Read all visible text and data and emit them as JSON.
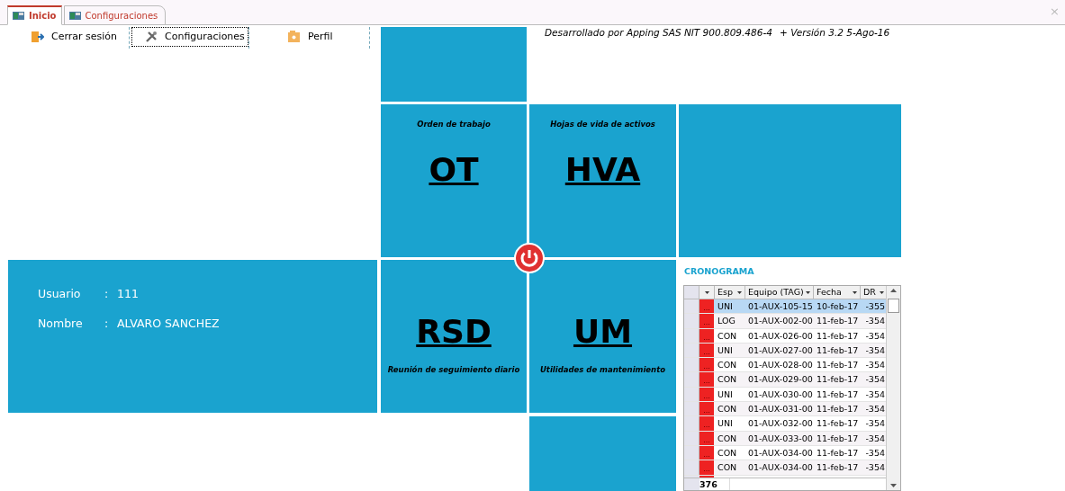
{
  "close_glyph": "×",
  "tabs": [
    {
      "label": "Inicio",
      "selected": true
    },
    {
      "label": "Configuraciones",
      "selected": false
    }
  ],
  "toolbar": [
    {
      "label": "Cerrar sesión",
      "kind": "logout",
      "focused": false
    },
    {
      "label": "Configuraciones",
      "kind": "tools",
      "focused": true
    },
    {
      "label": "Perfil",
      "kind": "profile",
      "focused": false
    }
  ],
  "developer_note": "Desarrollado por Apping SAS NIT 900.809.486-4",
  "version_note": "+ Versión 3.2  5-Ago-16",
  "tiles": [
    {
      "caption": "Orden de trabajo",
      "code": "OT",
      "kind": "caption-above"
    },
    {
      "caption": "Hojas de vida de activos",
      "code": "HVA",
      "kind": "caption-above"
    },
    {
      "caption": "Reunión de seguimiento diario",
      "code": "RSD",
      "kind": "caption-below"
    },
    {
      "caption": "Utilidades de mantenimiento",
      "code": "UM",
      "kind": "caption-below"
    }
  ],
  "user": {
    "fields": [
      {
        "label": "Usuario",
        "separator": ":",
        "value": "111"
      },
      {
        "label": "Nombre",
        "separator": ":",
        "value": "ALVARO SANCHEZ"
      }
    ]
  },
  "schedule": {
    "title": "CRONOGRAMA",
    "columns": [
      "Esp",
      "Equipo (TAG)",
      "Fecha",
      "DR"
    ],
    "rows": [
      {
        "esp": "UNI",
        "equipo": "01-AUX-105-15",
        "fecha": "10-feb-17",
        "dr": "-355",
        "selected": true
      },
      {
        "esp": "LOG",
        "equipo": "01-AUX-002-00",
        "fecha": "11-feb-17",
        "dr": "-354",
        "selected": false
      },
      {
        "esp": "CON",
        "equipo": "01-AUX-026-00",
        "fecha": "11-feb-17",
        "dr": "-354",
        "selected": false
      },
      {
        "esp": "UNI",
        "equipo": "01-AUX-027-00",
        "fecha": "11-feb-17",
        "dr": "-354",
        "selected": false
      },
      {
        "esp": "CON",
        "equipo": "01-AUX-028-00",
        "fecha": "11-feb-17",
        "dr": "-354",
        "selected": false
      },
      {
        "esp": "CON",
        "equipo": "01-AUX-029-00",
        "fecha": "11-feb-17",
        "dr": "-354",
        "selected": false
      },
      {
        "esp": "UNI",
        "equipo": "01-AUX-030-00",
        "fecha": "11-feb-17",
        "dr": "-354",
        "selected": false
      },
      {
        "esp": "CON",
        "equipo": "01-AUX-031-00",
        "fecha": "11-feb-17",
        "dr": "-354",
        "selected": false
      },
      {
        "esp": "UNI",
        "equipo": "01-AUX-032-00",
        "fecha": "11-feb-17",
        "dr": "-354",
        "selected": false
      },
      {
        "esp": "CON",
        "equipo": "01-AUX-033-00",
        "fecha": "11-feb-17",
        "dr": "-354",
        "selected": false
      },
      {
        "esp": "CON",
        "equipo": "01-AUX-034-00",
        "fecha": "11-feb-17",
        "dr": "-354",
        "selected": false
      },
      {
        "esp": "CON",
        "equipo": "01-AUX-034-00",
        "fecha": "11-feb-17",
        "dr": "-354",
        "selected": false
      }
    ],
    "row_button": "...",
    "total": "376"
  }
}
